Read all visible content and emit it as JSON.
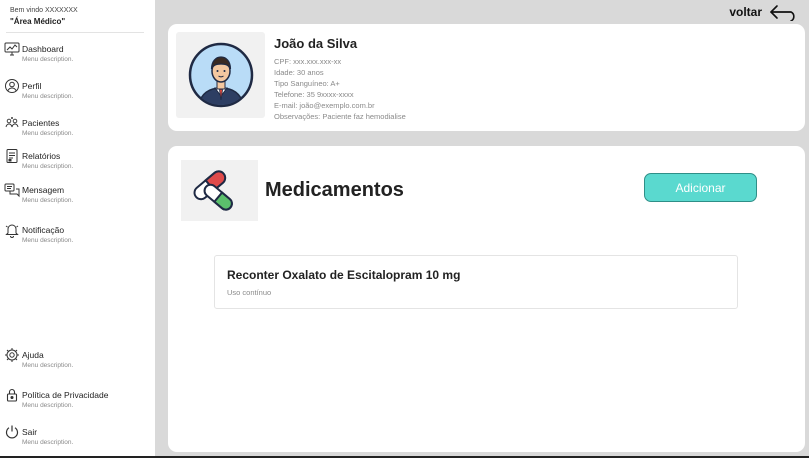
{
  "sidebar": {
    "welcome": "Bem vindo XXXXXXX",
    "area": "\"Área Médico\"",
    "items": [
      {
        "label": "Dashboard",
        "desc": "Menu description.",
        "icon": "dashboard-icon"
      },
      {
        "label": "Perfil",
        "desc": "Menu description.",
        "icon": "user-icon"
      },
      {
        "label": "Pacientes",
        "desc": "Menu description.",
        "icon": "patients-icon"
      },
      {
        "label": "Relatórios",
        "desc": "Menu description.",
        "icon": "report-icon"
      },
      {
        "label": "Mensagem",
        "desc": "Menu description.",
        "icon": "message-icon"
      },
      {
        "label": "Notificação",
        "desc": "Menu description.",
        "icon": "bell-icon"
      }
    ],
    "bottom_items": [
      {
        "label": "Ajuda",
        "desc": "Menu description.",
        "icon": "help-icon"
      },
      {
        "label": "Política de Privacidade",
        "desc": "Menu description.",
        "icon": "lock-icon"
      },
      {
        "label": "Sair",
        "desc": "Menu description.",
        "icon": "power-icon"
      }
    ]
  },
  "header": {
    "back_label": "voltar",
    "back_icon": "back-arrow-icon"
  },
  "patient": {
    "name": "João da Silva",
    "cpf": "CPF: xxx.xxx.xxx-xx",
    "idade": "Idade: 30 anos",
    "tipo": "Tipo Sanguíneo: A+",
    "telefone": "Telefone: 35 9xxxx-xxxx",
    "email": "E-mail: joão@exemplo.com.br",
    "obs": "Observações: Paciente faz hemodialise",
    "avatar_icon": "doctor-avatar-icon"
  },
  "medications": {
    "title": "Medicamentos",
    "icon": "pills-icon",
    "add_label": "Adicionar",
    "accent": "#5ad9cf",
    "items": [
      {
        "name": "Reconter Oxalato de Escitalopram 10 mg",
        "note": "Uso contínuo"
      }
    ]
  }
}
